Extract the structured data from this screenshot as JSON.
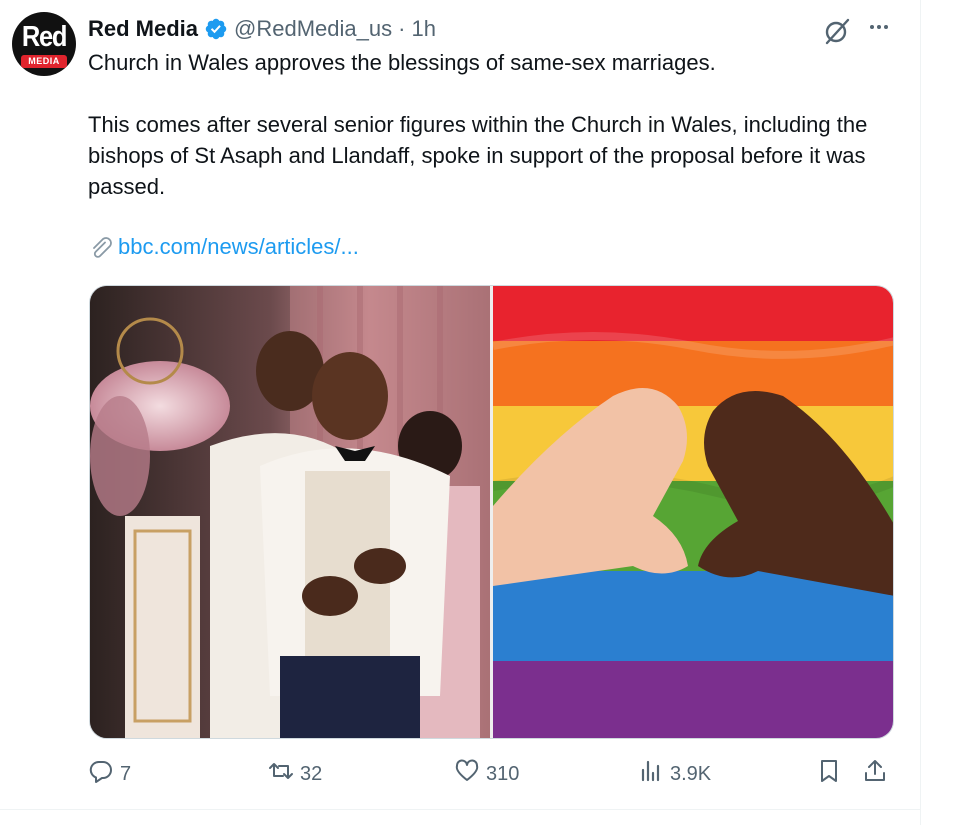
{
  "account": {
    "display_name": "Red Media",
    "handle": "@RedMedia_us",
    "separator": "·",
    "time": "1h",
    "avatar_word": "Red",
    "avatar_sub": "MEDIA"
  },
  "tweet": {
    "line1": "Church in Wales approves the blessings of same-sex marriages.",
    "paragraph2": "This comes after several senior figures within the Church in Wales, including the bishops of St Asaph and Llandaff, spoke in support of the proposal before it was passed.",
    "link_text": "bbc.com/news/articles/..."
  },
  "media": {
    "images": [
      "wedding-photo",
      "heart-hands-rainbow-photo"
    ]
  },
  "actions": {
    "replies": "7",
    "reposts": "32",
    "likes": "310",
    "views": "3.9K"
  },
  "colors": {
    "text": "#0f1419",
    "secondary": "#536471",
    "link": "#1d9bf0",
    "verified": "#1d9bf0",
    "brand_red": "#e0242d"
  },
  "icons": [
    "verified-icon",
    "grok-icon",
    "more-icon",
    "paperclip-icon",
    "reply-icon",
    "repost-icon",
    "like-icon",
    "views-icon",
    "bookmark-icon",
    "share-icon"
  ]
}
